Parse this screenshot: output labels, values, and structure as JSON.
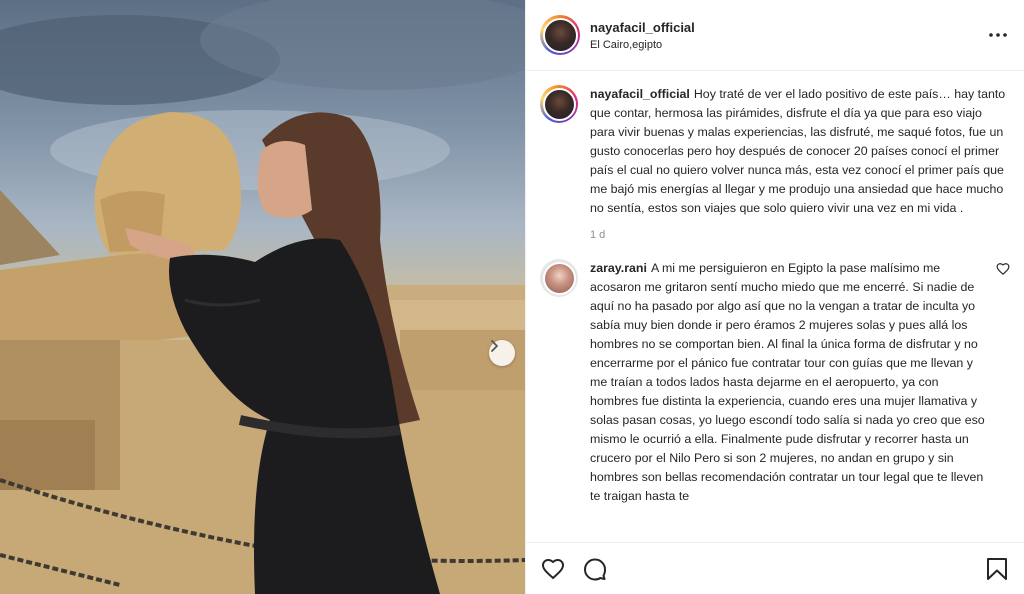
{
  "post": {
    "username": "nayafacil_official",
    "location": "El Cairo,egipto"
  },
  "caption": {
    "author": "nayafacil_official",
    "text": "Hoy traté de ver el lado positivo de este país… hay tanto que contar, hermosa las pirámides, disfrute el día ya que para eso viajo para vivir buenas y malas experiencias, las disfruté, me saqué fotos, fue un gusto conocerlas pero hoy después de conocer 20 países conocí el primer país el cual no quiero volver nunca más, esta vez conocí el primer país que me bajó mis energías al llegar y me produjo una ansiedad que hace mucho no sentía, estos son viajes que solo quiero vivir una vez en mi vida .",
    "time": "1 d"
  },
  "comments": [
    {
      "author": "zaray.rani",
      "text": "A mi me persiguieron en Egipto la pase malísimo me acosaron me gritaron sentí mucho miedo que me encerré. Si nadie de aquí no ha pasado por algo así que no la vengan a tratar de inculta yo sabía muy bien donde ir pero éramos 2 mujeres solas y pues allá los hombres no se comportan bien. Al final la única forma de disfrutar y no encerrarme por el pánico fue contratar tour con guías que me llevan y me traían a todos lados hasta dejarme en el aeropuerto, ya con hombres fue distinta la experiencia, cuando eres una mujer llamativa y solas pasan cosas, yo luego escondí todo salía si nada yo creo que eso mismo le ocurrió a ella. Finalmente pude disfrutar y recorrer hasta un crucero por el Nilo Pero si son 2 mujeres, no andan en grupo y sin hombres son bellas recomendación contratar un tour legal que te lleven te traigan hasta te"
    }
  ],
  "icons": {
    "more": "more-options-icon",
    "like": "heart-icon",
    "comment": "comment-icon",
    "save": "bookmark-icon",
    "next": "chevron-right-icon"
  }
}
